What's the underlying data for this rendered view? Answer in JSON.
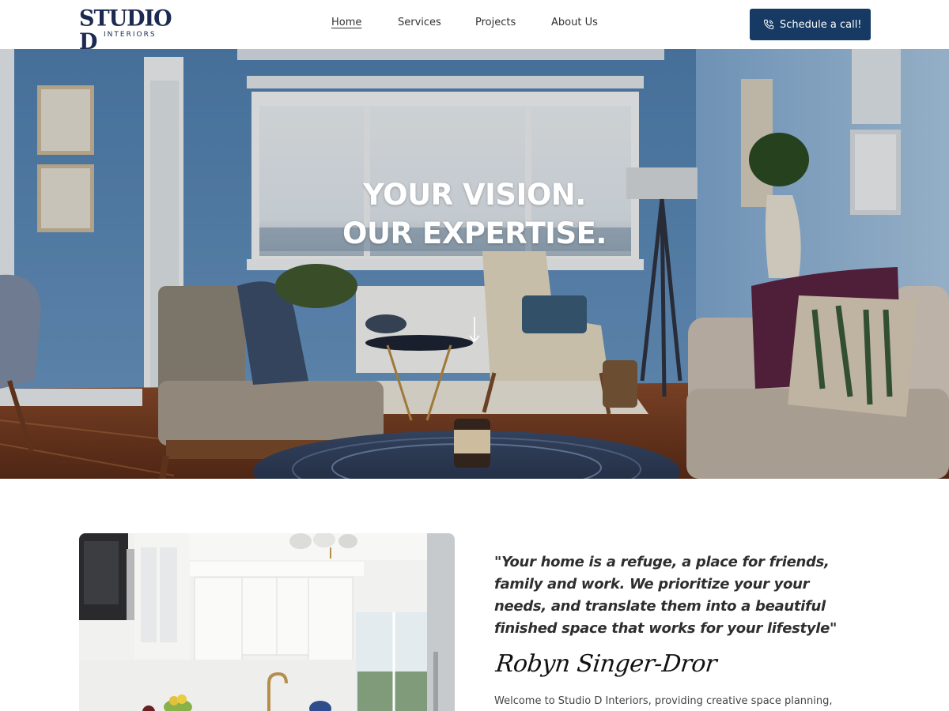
{
  "brand": {
    "logo_main": "STUDIO D",
    "logo_sub": "INTERIORS"
  },
  "nav": {
    "items": [
      {
        "label": "Home",
        "active": true
      },
      {
        "label": "Services",
        "active": false
      },
      {
        "label": "Projects",
        "active": false
      },
      {
        "label": "About Us",
        "active": false
      }
    ]
  },
  "cta": {
    "label": "Schedule a call!",
    "icon": "phone-icon",
    "color": "#163a63"
  },
  "hero": {
    "line1": "YOUR VISION.",
    "line2": "OUR EXPERTISE.",
    "scroll_icon": "arrow-down-icon"
  },
  "intro": {
    "quote_lines": [
      "\"Your home is a refuge, a place for friends,",
      "family and work. We prioritize your your",
      "needs, and translate them into a beautiful",
      "finished space that works for your lifestyle\""
    ],
    "signature": "Robyn Singer-Dror",
    "welcome": "Welcome to Studio D Interiors, providing creative space planning,"
  },
  "colors": {
    "brand_navy": "#1c2a52",
    "button": "#163a63",
    "wall_blue": "#5f8dbb"
  }
}
